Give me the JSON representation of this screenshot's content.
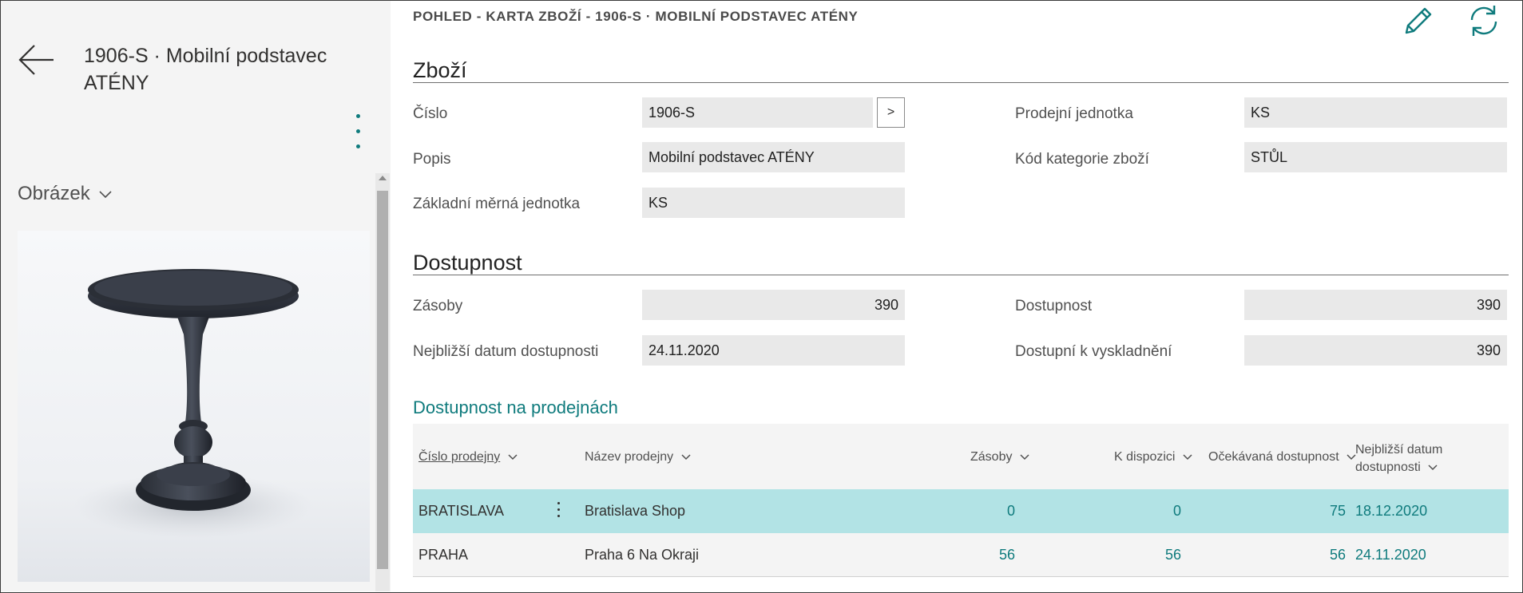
{
  "left_pane": {
    "item_title": "1906-S · Mobilní podstavec ATÉNY",
    "factbox_caption": "Obrázek"
  },
  "breadcrumb": "POHLED - KARTA ZBOŽÍ - 1906-S · MOBILNÍ PODSTAVEC ATÉNY",
  "sections": {
    "item": {
      "title": "Zboží",
      "fields": {
        "number_label": "Číslo",
        "number_value": "1906-S",
        "lookup_label": ">",
        "description_label": "Popis",
        "description_value": "Mobilní podstavec ATÉNY",
        "base_uom_label": "Základní měrná jednotka",
        "base_uom_value": "KS",
        "sales_unit_label": "Prodejní jednotka",
        "sales_unit_value": "KS",
        "category_label": "Kód kategorie zboží",
        "category_value": "STŮL"
      }
    },
    "availability": {
      "title": "Dostupnost",
      "fields": {
        "inventory_label": "Zásoby",
        "inventory_value": "390",
        "earliest_date_label": "Nejbližší datum dostupnosti",
        "earliest_date_value": "24.11.2020",
        "availability_label": "Dostupnost",
        "availability_value": "390",
        "pickable_label": "Dostupní k vyskladnění",
        "pickable_value": "390"
      }
    }
  },
  "store_part": {
    "title": "Dostupnost na prodejnách",
    "columns": {
      "store_no": "Číslo prodejny",
      "store_name": "Název prodejny",
      "inventory": "Zásoby",
      "available": "K dispozici",
      "expected": "Očekávaná dostupnost",
      "earliest_date_line1": "Nejbližší datum",
      "earliest_date_line2": "dostupnosti"
    },
    "rows": [
      {
        "store_no": "BRATISLAVA",
        "store_name": "Bratislava Shop",
        "inventory": "0",
        "available": "0",
        "expected": "75",
        "earliest_date": "18.12.2020"
      },
      {
        "store_no": "PRAHA",
        "store_name": "Praha 6 Na Okraji",
        "inventory": "56",
        "available": "56",
        "expected": "56",
        "earliest_date": "24.11.2020"
      }
    ]
  },
  "colors": {
    "accent": "#0f7b7d",
    "selected_row": "#b2e3e5",
    "field_bg": "#e9e9e9",
    "pane_bg": "#f4f4f4"
  },
  "icons": {
    "back": "arrow-left-icon",
    "more": "vertical-ellipsis-icon",
    "edit": "pencil-icon",
    "refresh": "refresh-icon",
    "chevron": "chevron-down-icon"
  }
}
